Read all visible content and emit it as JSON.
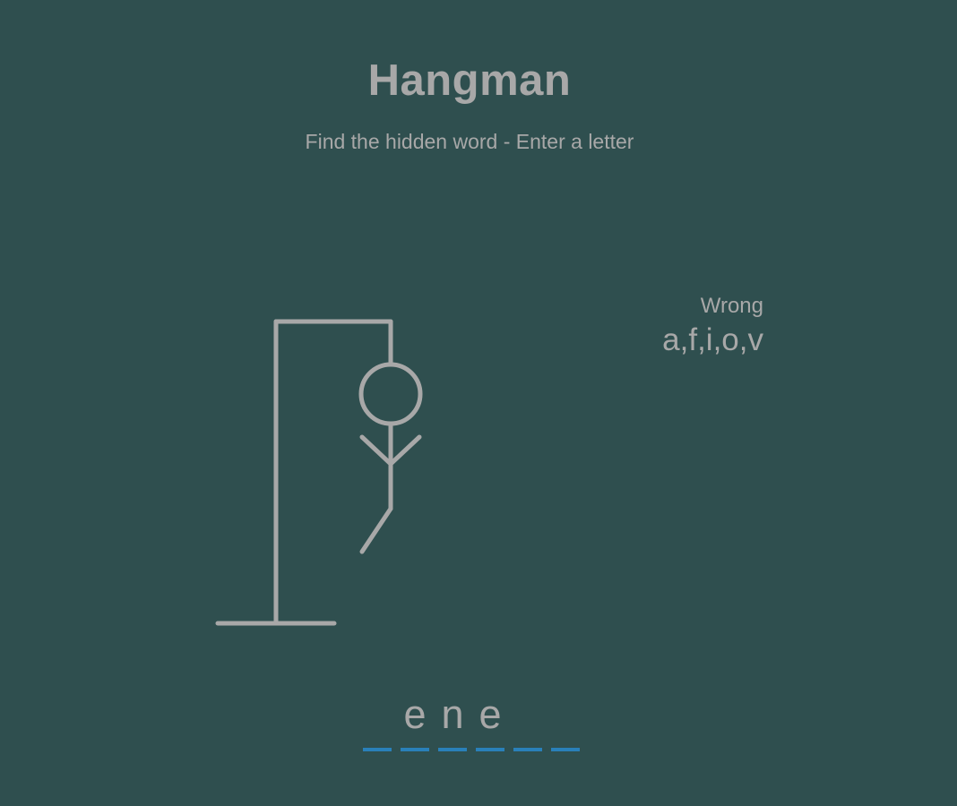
{
  "header": {
    "title": "Hangman",
    "subtitle": "Find the hidden word - Enter a letter"
  },
  "wrong": {
    "label": "Wrong",
    "letters": "a,f,i,o,v"
  },
  "word": {
    "letters": [
      "",
      "e",
      "n",
      "e",
      "",
      ""
    ]
  },
  "hangman": {
    "parts_shown": [
      "head",
      "body",
      "left-arm",
      "right-arm",
      "left-leg"
    ],
    "parts_hidden": [
      "right-leg"
    ]
  },
  "colors": {
    "background": "#2f4f4f",
    "foreground": "#a8a8a8",
    "dash": "#2980b9"
  }
}
